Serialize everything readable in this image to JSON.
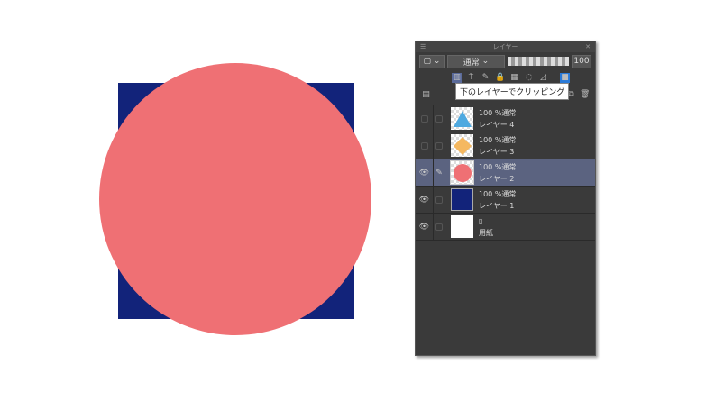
{
  "panel": {
    "title": "レイヤー",
    "blend_mode": "通常",
    "opacity": "100",
    "tooltip": "下のレイヤーでクリッピング"
  },
  "layers": [
    {
      "mode": "100 %通常",
      "name": "レイヤー 4",
      "visible": false,
      "thumb": "triangle",
      "color": "#4ea9e0"
    },
    {
      "mode": "100 %通常",
      "name": "レイヤー 3",
      "visible": false,
      "thumb": "diamond",
      "color": "#f5b860"
    },
    {
      "mode": "100 %通常",
      "name": "レイヤー 2",
      "visible": true,
      "selected": true,
      "thumb": "circle",
      "color": "#ef7074"
    },
    {
      "mode": "100 %通常",
      "name": "レイヤー 1",
      "visible": true,
      "thumb": "square",
      "color": "#12237a"
    }
  ],
  "paper": {
    "name": "用紙"
  },
  "colors": {
    "square": "#12237a",
    "circle": "#ef7074"
  }
}
